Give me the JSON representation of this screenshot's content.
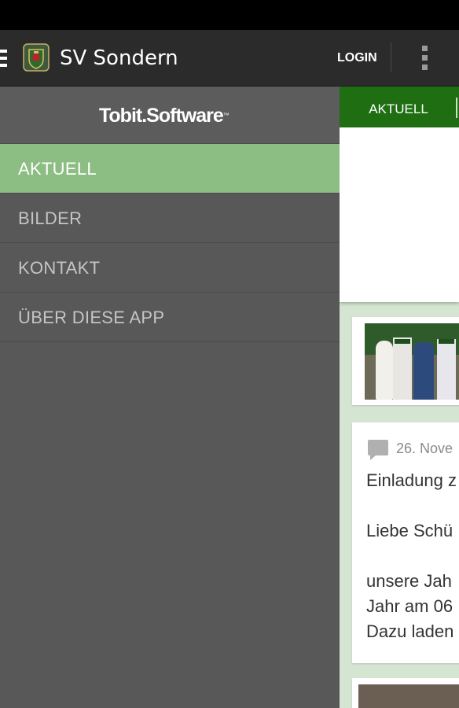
{
  "action_bar": {
    "title": "SV Sondern",
    "login_label": "LOGIN"
  },
  "drawer": {
    "brand": "Tobit.Software",
    "brand_tm": "™",
    "items": [
      {
        "label": "AKTUELL",
        "active": true
      },
      {
        "label": "BILDER",
        "active": false
      },
      {
        "label": "KONTAKT",
        "active": false
      },
      {
        "label": "ÜBER DIESE APP",
        "active": false
      }
    ]
  },
  "content": {
    "active_tab": "AKTUELL",
    "article": {
      "date": "26. Nove",
      "lines": [
        "Einladung z",
        "Liebe Schü",
        "unsere Jah",
        "Jahr am 06",
        "Dazu laden"
      ]
    }
  },
  "colors": {
    "action_bar": "#2b2b2b",
    "drawer": "#585858",
    "active_item": "#8cbd82",
    "tab_bar": "#1f6e12",
    "content_bg": "#d4e6d1"
  },
  "icons": [
    "menu-icon",
    "app-logo",
    "overflow-menu-icon",
    "comment-icon"
  ]
}
